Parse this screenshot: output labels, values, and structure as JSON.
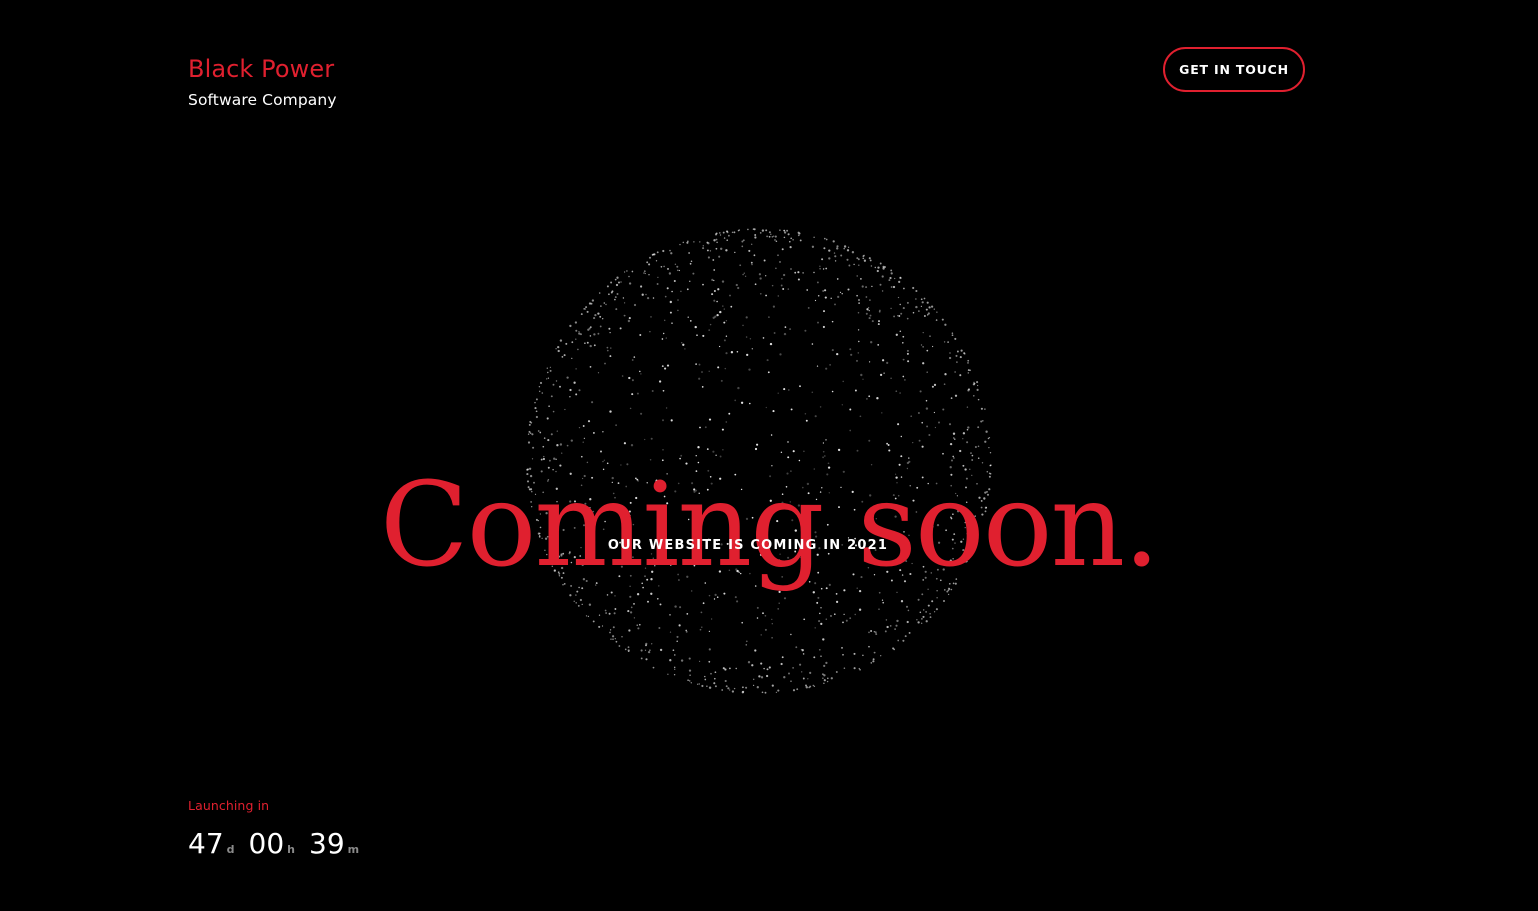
{
  "header": {
    "brand_name": "Black Power",
    "brand_tagline": "Software Company",
    "cta_label": "GET IN TOUCH"
  },
  "hero": {
    "title": "Coming soon.",
    "subtitle": "OUR WEBSITE IS COMING IN 2021"
  },
  "launch": {
    "label": "Launching in",
    "countdown": [
      {
        "value": "47",
        "suffix": "d"
      },
      {
        "value": "00",
        "suffix": "h"
      },
      {
        "value": "39",
        "suffix": "m"
      }
    ]
  },
  "colors": {
    "background": "#000000",
    "accent": "#e0202f",
    "text": "#ffffff",
    "muted": "#8a8a8a"
  },
  "decor": {
    "globe_icon": "particle-globe-icon"
  }
}
